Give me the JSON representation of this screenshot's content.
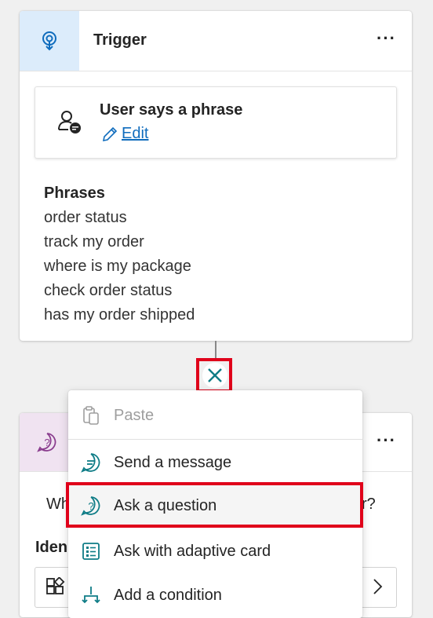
{
  "trigger": {
    "title": "Trigger",
    "more_label": "···",
    "phrase_box": {
      "title": "User says a phrase",
      "edit_label": "Edit"
    },
    "phrases_heading": "Phrases",
    "phrases": [
      "order status",
      "track my order",
      "where is my package",
      "check order status",
      "has my order shipped"
    ]
  },
  "question_node": {
    "more_label": "···",
    "text_left": "Wh",
    "text_right": "r?",
    "identify_label": "Iden"
  },
  "menu": {
    "items": [
      {
        "label": "Paste",
        "icon": "paste-icon",
        "disabled": true
      },
      {
        "label": "Send a message",
        "icon": "message-icon",
        "disabled": false
      },
      {
        "label": "Ask a question",
        "icon": "question-icon",
        "disabled": false,
        "highlighted": true
      },
      {
        "label": "Ask with adaptive card",
        "icon": "adaptive-card-icon",
        "disabled": false
      },
      {
        "label": "Add a condition",
        "icon": "branch-icon",
        "disabled": false
      }
    ]
  },
  "colors": {
    "accent": "#0f6cbd",
    "highlight_border": "#e0001a",
    "trigger_icon_bg": "#dcecfb",
    "question_icon_bg": "#f0e3f1",
    "question_icon": "#8a3d8e",
    "teal": "#0e7c86"
  }
}
